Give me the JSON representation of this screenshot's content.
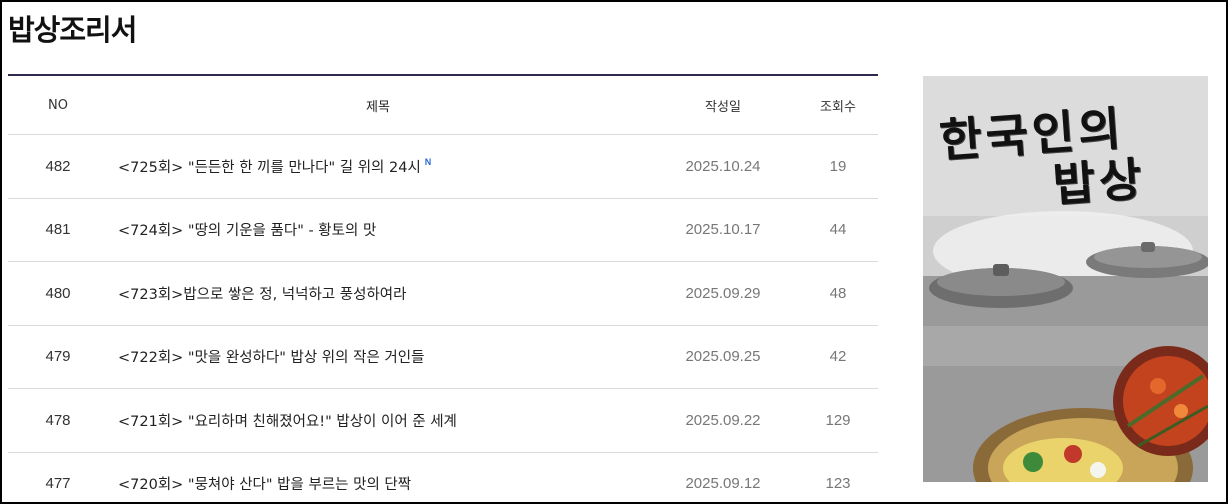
{
  "page": {
    "title": "밥상조리서"
  },
  "table": {
    "headers": {
      "no": "NO",
      "title": "제목",
      "date": "작성일",
      "views": "조회수"
    },
    "rows": [
      {
        "no": "482",
        "title": "<725회> \"든든한 한 끼를 만나다\" 길 위의 24시",
        "is_new": true,
        "new_label": "N",
        "date": "2025.10.24",
        "views": "19"
      },
      {
        "no": "481",
        "title": "<724회> \"땅의 기운을 품다\" - 황토의 맛",
        "is_new": false,
        "date": "2025.10.17",
        "views": "44"
      },
      {
        "no": "480",
        "title": "<723회>밥으로 쌓은 정, 넉넉하고 풍성하여라",
        "is_new": false,
        "date": "2025.09.29",
        "views": "48"
      },
      {
        "no": "479",
        "title": "<722회> \"맛을 완성하다\" 밥상 위의 작은 거인들",
        "is_new": false,
        "date": "2025.09.25",
        "views": "42"
      },
      {
        "no": "478",
        "title": "<721회> \"요리하며 친해졌어요!\" 밥상이 이어 준 세계",
        "is_new": false,
        "date": "2025.09.22",
        "views": "129"
      },
      {
        "no": "477",
        "title": "<720회> \"뭉쳐야 산다\" 밥을 부르는 맛의 단짝",
        "is_new": false,
        "date": "2025.09.12",
        "views": "123"
      }
    ]
  },
  "poster": {
    "line1": "한국인의",
    "line2": "밥상"
  },
  "colors": {
    "header_rule": "#2e2a4e",
    "new_badge": "#2a6ad8",
    "muted_text": "#777777"
  }
}
